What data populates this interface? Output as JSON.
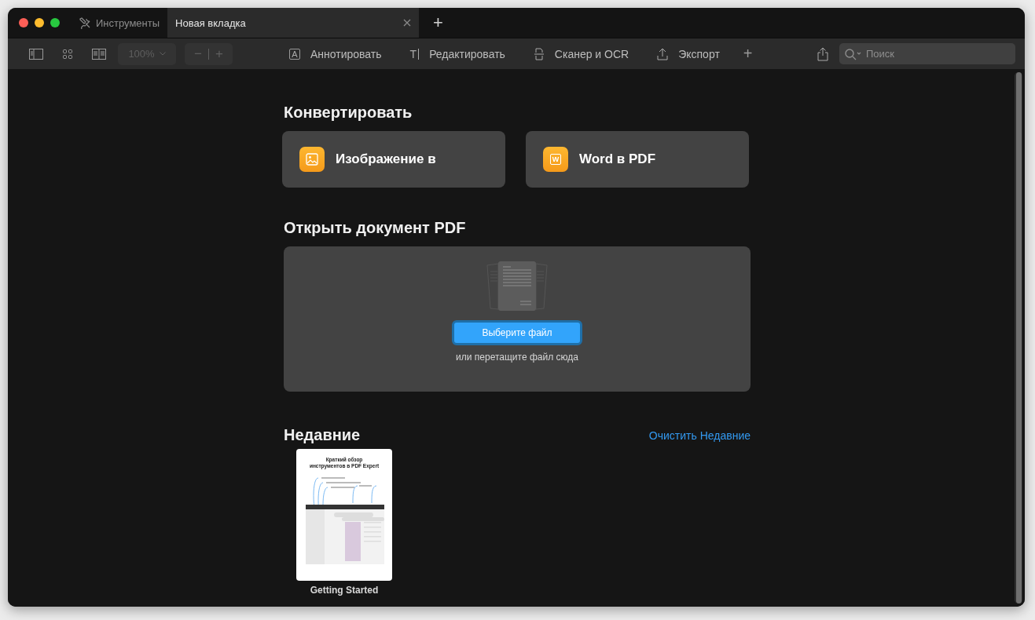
{
  "tabs": [
    {
      "label": "Инструменты",
      "selected": false,
      "kind": "tools"
    },
    {
      "label": "Новая вкладка",
      "selected": true,
      "kind": "document"
    }
  ],
  "new_tab_button": "+",
  "toolbar": {
    "zoom": {
      "value": "100%",
      "disabled": true,
      "zoom_out": "−",
      "zoom_in": "+"
    },
    "tools": [
      {
        "label": "Аннотировать",
        "kind": "annotate",
        "icon_letter": "A"
      },
      {
        "label": "Редактировать",
        "kind": "edit",
        "icon_letter": "T"
      },
      {
        "label": "Сканер и OCR",
        "kind": "scan"
      },
      {
        "label": "Экспорт",
        "kind": "export"
      }
    ],
    "add_tool": "+",
    "search": {
      "placeholder": "Поиск"
    }
  },
  "convert": {
    "title": "Конвертировать",
    "cards": [
      {
        "label": "Изображение в",
        "kind": "image"
      },
      {
        "label": "Word в PDF",
        "kind": "word",
        "icon_letter": "W"
      }
    ]
  },
  "open": {
    "title": "Открыть документ PDF",
    "button": "Выберите файл",
    "hint": "или перетащите файл сюда"
  },
  "recent": {
    "title": "Недавние",
    "clear": "Очистить Недавние",
    "files": [
      {
        "name": "Getting Started",
        "preview_title": "Краткий обзор инструментов в PDF Expert"
      }
    ]
  }
}
